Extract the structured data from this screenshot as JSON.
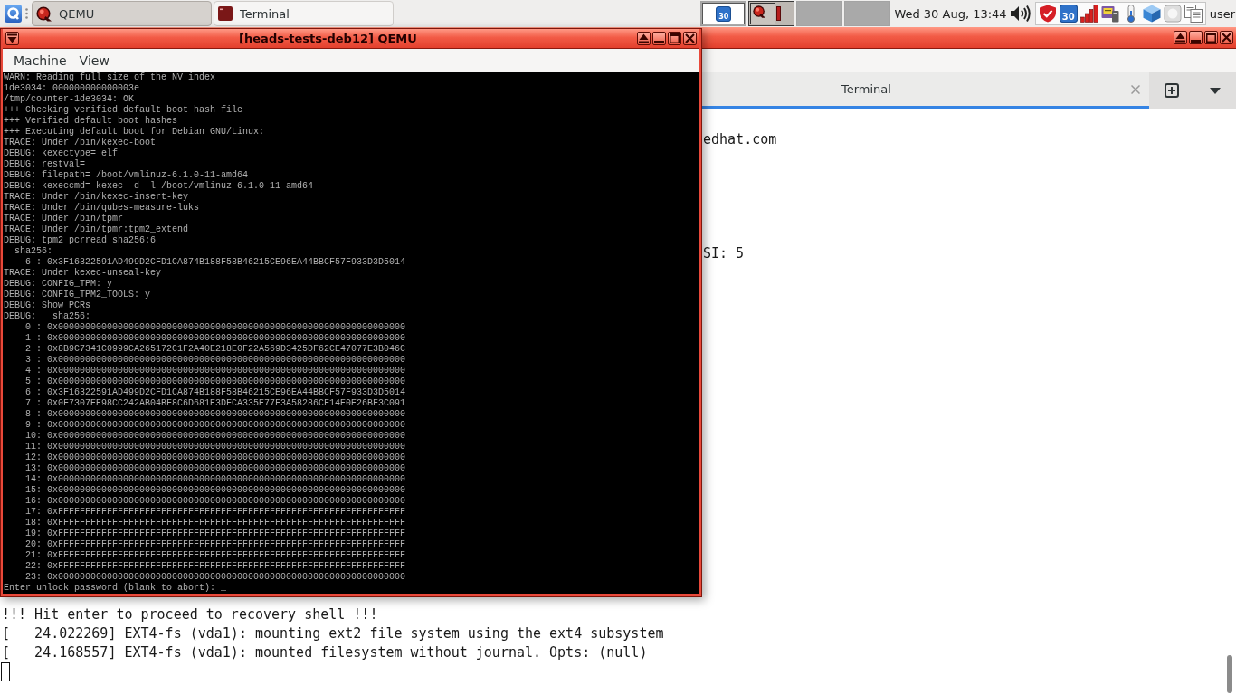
{
  "taskbar": {
    "tasks": [
      {
        "label": "QEMU",
        "kind": "qemu",
        "selected": true
      },
      {
        "label": "Terminal",
        "kind": "terminal",
        "selected": false
      }
    ],
    "workspaces": [
      {
        "selected": false,
        "windows": [
          {
            "kind": "updates",
            "badge": "30"
          }
        ]
      },
      {
        "selected": true,
        "windows": [
          {
            "kind": "qemu"
          },
          {
            "kind": "terminal"
          }
        ]
      },
      {
        "selected": false
      },
      {
        "selected": false
      }
    ],
    "clock": "Wed 30 Aug, 13:44",
    "tray": [
      {
        "kind": "shield"
      },
      {
        "kind": "updates",
        "badge": "30"
      },
      {
        "kind": "signal"
      },
      {
        "kind": "devices"
      },
      {
        "kind": "thermometer"
      },
      {
        "kind": "cube"
      },
      {
        "kind": "drive"
      },
      {
        "kind": "notes"
      }
    ],
    "user": "user"
  },
  "qemu_window": {
    "title": "[heads-tests-deb12] QEMU",
    "menu": [
      "Machine",
      "View"
    ],
    "console": [
      "WARN: Reading full size of the NV index",
      "1de3034: 000000000000003e",
      "/tmp/counter-1de3034: OK",
      "+++ Checking verified default boot hash file",
      "+++ Verified default boot hashes",
      "+++ Executing default boot for Debian GNU/Linux:",
      "TRACE: Under /bin/kexec-boot",
      "DEBUG: kexectype= elf",
      "DEBUG: restval=",
      "DEBUG: filepath= /boot/vmlinuz-6.1.0-11-amd64",
      "DEBUG: kexeccmd= kexec -d -l /boot/vmlinuz-6.1.0-11-amd64",
      "TRACE: Under /bin/kexec-insert-key",
      "TRACE: Under /bin/qubes-measure-luks",
      "TRACE: Under /bin/tpmr",
      "TRACE: Under /bin/tpmr:tpm2_extend",
      "DEBUG: tpm2 pcrread sha256:6",
      "  sha256:",
      "    6 : 0x3F16322591AD499D2CFD1CA874B188F58B46215CE96EA44BBCF57F933D3D5014",
      "TRACE: Under kexec-unseal-key",
      "DEBUG: CONFIG_TPM: y",
      "DEBUG: CONFIG_TPM2_TOOLS: y",
      "DEBUG: Show PCRs",
      "DEBUG:   sha256:",
      "    0 : 0x0000000000000000000000000000000000000000000000000000000000000000",
      "    1 : 0x0000000000000000000000000000000000000000000000000000000000000000",
      "    2 : 0x8B9C7341C0999CA265172C1F2A40E218E0F22A569D3425DF62CE47077E3B046C",
      "    3 : 0x0000000000000000000000000000000000000000000000000000000000000000",
      "    4 : 0x0000000000000000000000000000000000000000000000000000000000000000",
      "    5 : 0x0000000000000000000000000000000000000000000000000000000000000000",
      "    6 : 0x3F16322591AD499D2CFD1CA874B188F58B46215CE96EA44BBCF57F933D3D5014",
      "    7 : 0x0F7307EE98CC242AB04BF8C6D681E3DFCA335E77F3A58286CF14E0E26BF3C091",
      "    8 : 0x0000000000000000000000000000000000000000000000000000000000000000",
      "    9 : 0x0000000000000000000000000000000000000000000000000000000000000000",
      "    10: 0x0000000000000000000000000000000000000000000000000000000000000000",
      "    11: 0x0000000000000000000000000000000000000000000000000000000000000000",
      "    12: 0x0000000000000000000000000000000000000000000000000000000000000000",
      "    13: 0x0000000000000000000000000000000000000000000000000000000000000000",
      "    14: 0x0000000000000000000000000000000000000000000000000000000000000000",
      "    15: 0x0000000000000000000000000000000000000000000000000000000000000000",
      "    16: 0x0000000000000000000000000000000000000000000000000000000000000000",
      "    17: 0xFFFFFFFFFFFFFFFFFFFFFFFFFFFFFFFFFFFFFFFFFFFFFFFFFFFFFFFFFFFFFFFF",
      "    18: 0xFFFFFFFFFFFFFFFFFFFFFFFFFFFFFFFFFFFFFFFFFFFFFFFFFFFFFFFFFFFFFFFF",
      "    19: 0xFFFFFFFFFFFFFFFFFFFFFFFFFFFFFFFFFFFFFFFFFFFFFFFFFFFFFFFFFFFFFFFF",
      "    20: 0xFFFFFFFFFFFFFFFFFFFFFFFFFFFFFFFFFFFFFFFFFFFFFFFFFFFFFFFFFFFFFFFF",
      "    21: 0xFFFFFFFFFFFFFFFFFFFFFFFFFFFFFFFFFFFFFFFFFFFFFFFFFFFFFFFFFFFFFFFF",
      "    22: 0xFFFFFFFFFFFFFFFFFFFFFFFFFFFFFFFFFFFFFFFFFFFFFFFFFFFFFFFFFFFFFFFF",
      "    23: 0x0000000000000000000000000000000000000000000000000000000000000000",
      "Enter unlock password (blank to abort): _"
    ]
  },
  "terminal_window": {
    "tab": {
      "label": "Terminal",
      "selected": true
    },
    "visible_lines": [
      "edhat.com",
      "SI: 5"
    ],
    "lines": [
      "!!! Hit enter to proceed to recovery shell !!!",
      "[   24.022269] EXT4-fs (vda1): mounting ext2 file system using the ext4 subsystem",
      "[   24.168557] EXT4-fs (vda1): mounted filesystem without journal. Opts: (null)"
    ]
  }
}
